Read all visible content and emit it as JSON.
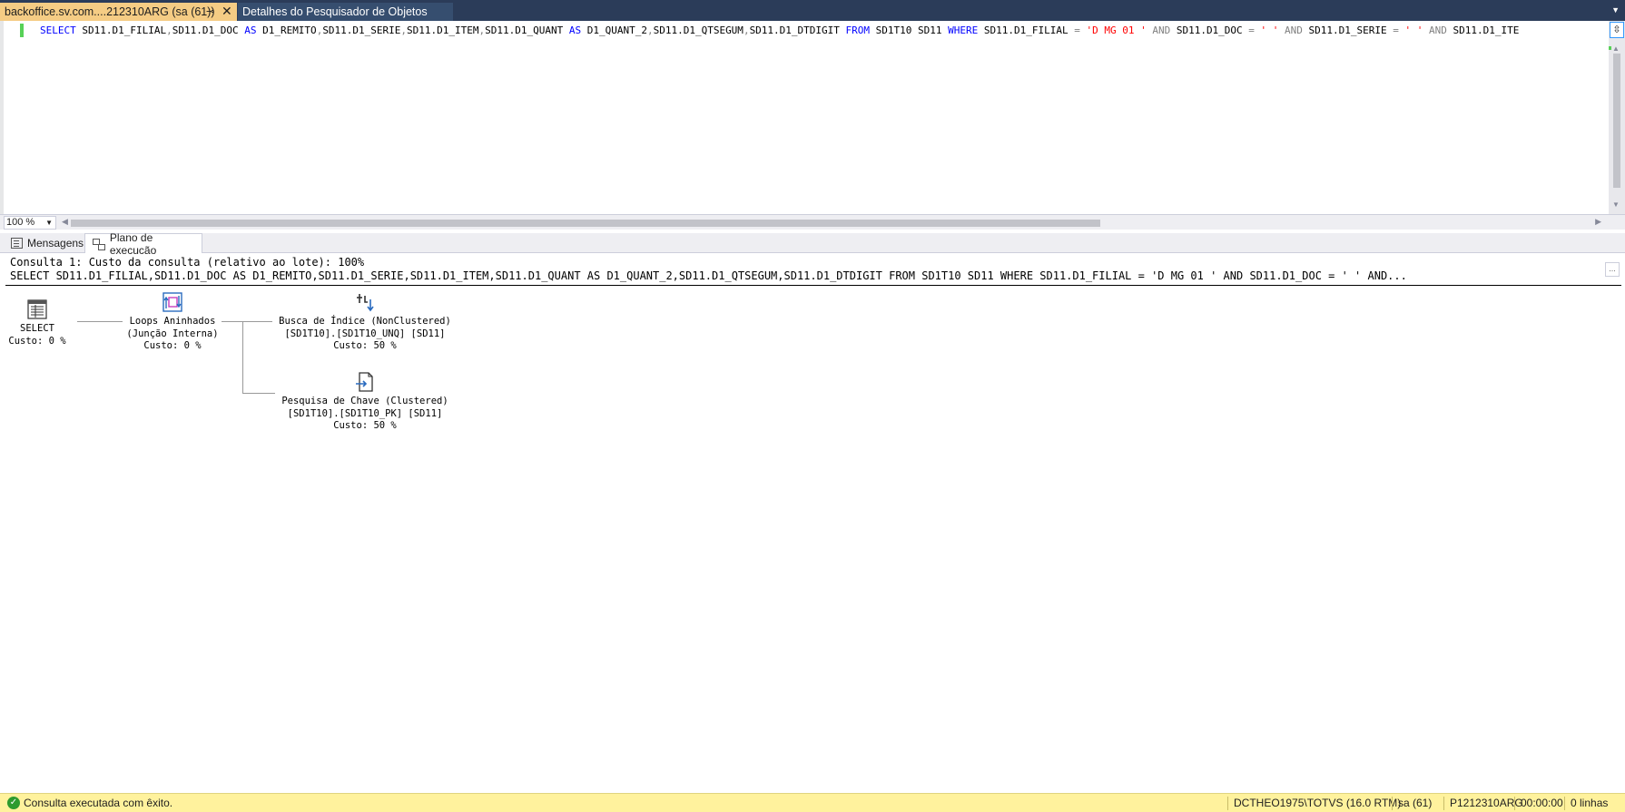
{
  "tabs": {
    "active_label": "backoffice.sv.com....212310ARG (sa (61))",
    "pin_icon": "⊸",
    "close_icon": "✕",
    "inactive_label": "Detalhes do Pesquisador de Objetos"
  },
  "editor": {
    "zoom": "100 %",
    "sql": [
      {
        "t": "SELECT",
        "c": "kw"
      },
      {
        "t": " SD11.D1_FILIAL",
        "c": ""
      },
      {
        "t": ",",
        "c": "op"
      },
      {
        "t": "SD11.D1_DOC ",
        "c": ""
      },
      {
        "t": "AS",
        "c": "kw"
      },
      {
        "t": " D1_REMITO",
        "c": ""
      },
      {
        "t": ",",
        "c": "op"
      },
      {
        "t": "SD11.D1_SERIE",
        "c": ""
      },
      {
        "t": ",",
        "c": "op"
      },
      {
        "t": "SD11.D1_ITEM",
        "c": ""
      },
      {
        "t": ",",
        "c": "op"
      },
      {
        "t": "SD11.D1_QUANT ",
        "c": ""
      },
      {
        "t": "AS",
        "c": "kw"
      },
      {
        "t": " D1_QUANT_2",
        "c": ""
      },
      {
        "t": ",",
        "c": "op"
      },
      {
        "t": "SD11.D1_QTSEGUM",
        "c": ""
      },
      {
        "t": ",",
        "c": "op"
      },
      {
        "t": "SD11.D1_DTDIGIT ",
        "c": ""
      },
      {
        "t": "FROM",
        "c": "kw"
      },
      {
        "t": " SD1T10 SD11 ",
        "c": ""
      },
      {
        "t": "WHERE",
        "c": "kw"
      },
      {
        "t": "  SD11.D1_FILIAL ",
        "c": ""
      },
      {
        "t": "=",
        "c": "op"
      },
      {
        "t": " 'D MG 01 '",
        "c": "str"
      },
      {
        "t": " AND",
        "c": "op"
      },
      {
        "t": " SD11.D1_DOC ",
        "c": ""
      },
      {
        "t": "=",
        "c": "op"
      },
      {
        "t": " ' '",
        "c": "str"
      },
      {
        "t": " AND",
        "c": "op"
      },
      {
        "t": " SD11.D1_SERIE ",
        "c": ""
      },
      {
        "t": "=",
        "c": "op"
      },
      {
        "t": " ' '",
        "c": "str"
      },
      {
        "t": " AND",
        "c": "op"
      },
      {
        "t": " SD11.D1_ITE",
        "c": ""
      }
    ]
  },
  "results_tabs": {
    "messages": "Mensagens",
    "plan": "Plano de execução"
  },
  "plan": {
    "header_line1": "Consulta 1: Custo da consulta (relativo ao lote): 100%",
    "header_line2": "SELECT SD11.D1_FILIAL,SD11.D1_DOC AS D1_REMITO,SD11.D1_SERIE,SD11.D1_ITEM,SD11.D1_QUANT AS D1_QUANT_2,SD11.D1_QTSEGUM,SD11.D1_DTDIGIT FROM SD1T10 SD11 WHERE SD11.D1_FILIAL = 'D MG 01 ' AND SD11.D1_DOC = ' ' AND...",
    "more_label": "...",
    "nodes": {
      "select": {
        "title": "SELECT",
        "cost": "Custo: 0 %",
        "icon": "table-icon"
      },
      "loops": {
        "title": "Loops Aninhados",
        "subtitle": "(Junção Interna)",
        "cost": "Custo: 0 %",
        "icon": "nested-loops-icon"
      },
      "seek": {
        "title": "Busca de Índice (NonClustered)",
        "subtitle": "[SD1T10].[SD1T10_UNQ] [SD11]",
        "cost": "Custo: 50 %",
        "icon": "index-seek-icon"
      },
      "lookup": {
        "title": "Pesquisa de Chave (Clustered)",
        "subtitle": "[SD1T10].[SD1T10_PK] [SD11]",
        "cost": "Custo: 50 %",
        "icon": "key-lookup-icon"
      }
    }
  },
  "status": {
    "message": "Consulta executada com êxito.",
    "server": "DCTHEO1975\\TOTVS (16.0 RTM)",
    "user": "sa (61)",
    "database": "P1212310ARG",
    "time": "00:00:00",
    "rows": "0 linhas"
  },
  "colors": {
    "tab_active": "#f5cc84",
    "tab_bar": "#2b3c59",
    "status_bar": "#fff29d",
    "keyword": "#0000ff",
    "string": "#ff0000"
  }
}
